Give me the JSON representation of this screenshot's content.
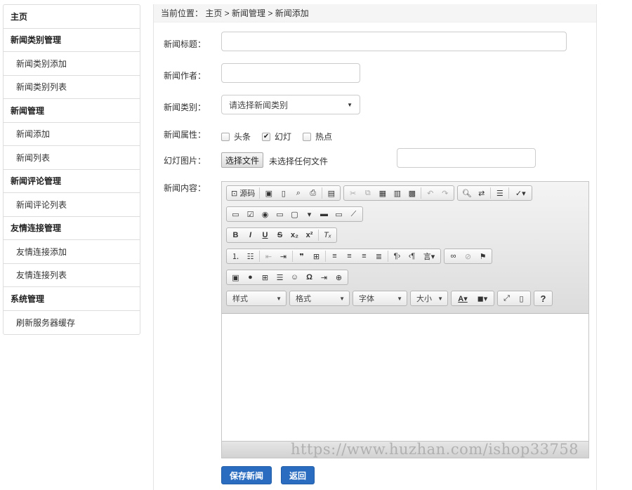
{
  "sidebar": {
    "items": [
      {
        "label": "主页",
        "type": "head"
      },
      {
        "label": "新闻类别管理",
        "type": "head"
      },
      {
        "label": "新闻类别添加",
        "type": "sub"
      },
      {
        "label": "新闻类别列表",
        "type": "sub"
      },
      {
        "label": "新闻管理",
        "type": "head"
      },
      {
        "label": "新闻添加",
        "type": "sub"
      },
      {
        "label": "新闻列表",
        "type": "sub"
      },
      {
        "label": "新闻评论管理",
        "type": "head"
      },
      {
        "label": "新闻评论列表",
        "type": "sub"
      },
      {
        "label": "友情连接管理",
        "type": "head"
      },
      {
        "label": "友情连接添加",
        "type": "sub"
      },
      {
        "label": "友情连接列表",
        "type": "sub"
      },
      {
        "label": "系统管理",
        "type": "head"
      },
      {
        "label": "刷新服务器缓存",
        "type": "sub"
      }
    ]
  },
  "breadcrumb": {
    "prefix": "当前位置：",
    "path": " 主页 > 新闻管理 > 新闻添加"
  },
  "form": {
    "title_label": "新闻标题：",
    "title_value": "",
    "author_label": "新闻作者：",
    "author_value": "",
    "category_label": "新闻类别：",
    "category_selected": "请选择新闻类别",
    "attr_label": "新闻属性：",
    "attrs": [
      {
        "label": "头条",
        "checked": false
      },
      {
        "label": "幻灯",
        "checked": true
      },
      {
        "label": "热点",
        "checked": false
      }
    ],
    "image_label": "幻灯图片：",
    "file_button": "选择文件",
    "file_status": "未选择任何文件",
    "image_text_value": "",
    "content_label": "新闻内容："
  },
  "editor": {
    "source_label": "源码",
    "combos": {
      "style": "样式",
      "format": "格式",
      "font": "字体",
      "size": "大小"
    }
  },
  "actions": {
    "save_label": "保存新闻",
    "back_label": "返回"
  },
  "watermark": "https://www.huzhan.com/ishop33758"
}
